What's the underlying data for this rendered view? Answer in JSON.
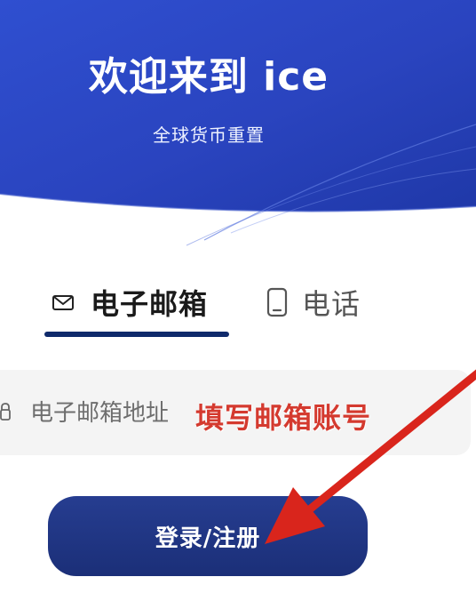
{
  "header": {
    "title": "欢迎来到 ice",
    "subtitle": "全球货币重置"
  },
  "tabs": [
    {
      "label": "电子邮箱",
      "icon": "mail-icon",
      "active": true
    },
    {
      "label": "电话",
      "icon": "phone-icon",
      "active": false
    }
  ],
  "email_input": {
    "placeholder": "电子邮箱地址",
    "value": ""
  },
  "annotation": {
    "text": "填写邮箱账号",
    "color": "#d43a2f"
  },
  "login_button": {
    "label": "登录/注册"
  },
  "colors": {
    "brand": "#2a45b8",
    "button": "#1f357f",
    "tab_indicator": "#0f2a6b"
  }
}
